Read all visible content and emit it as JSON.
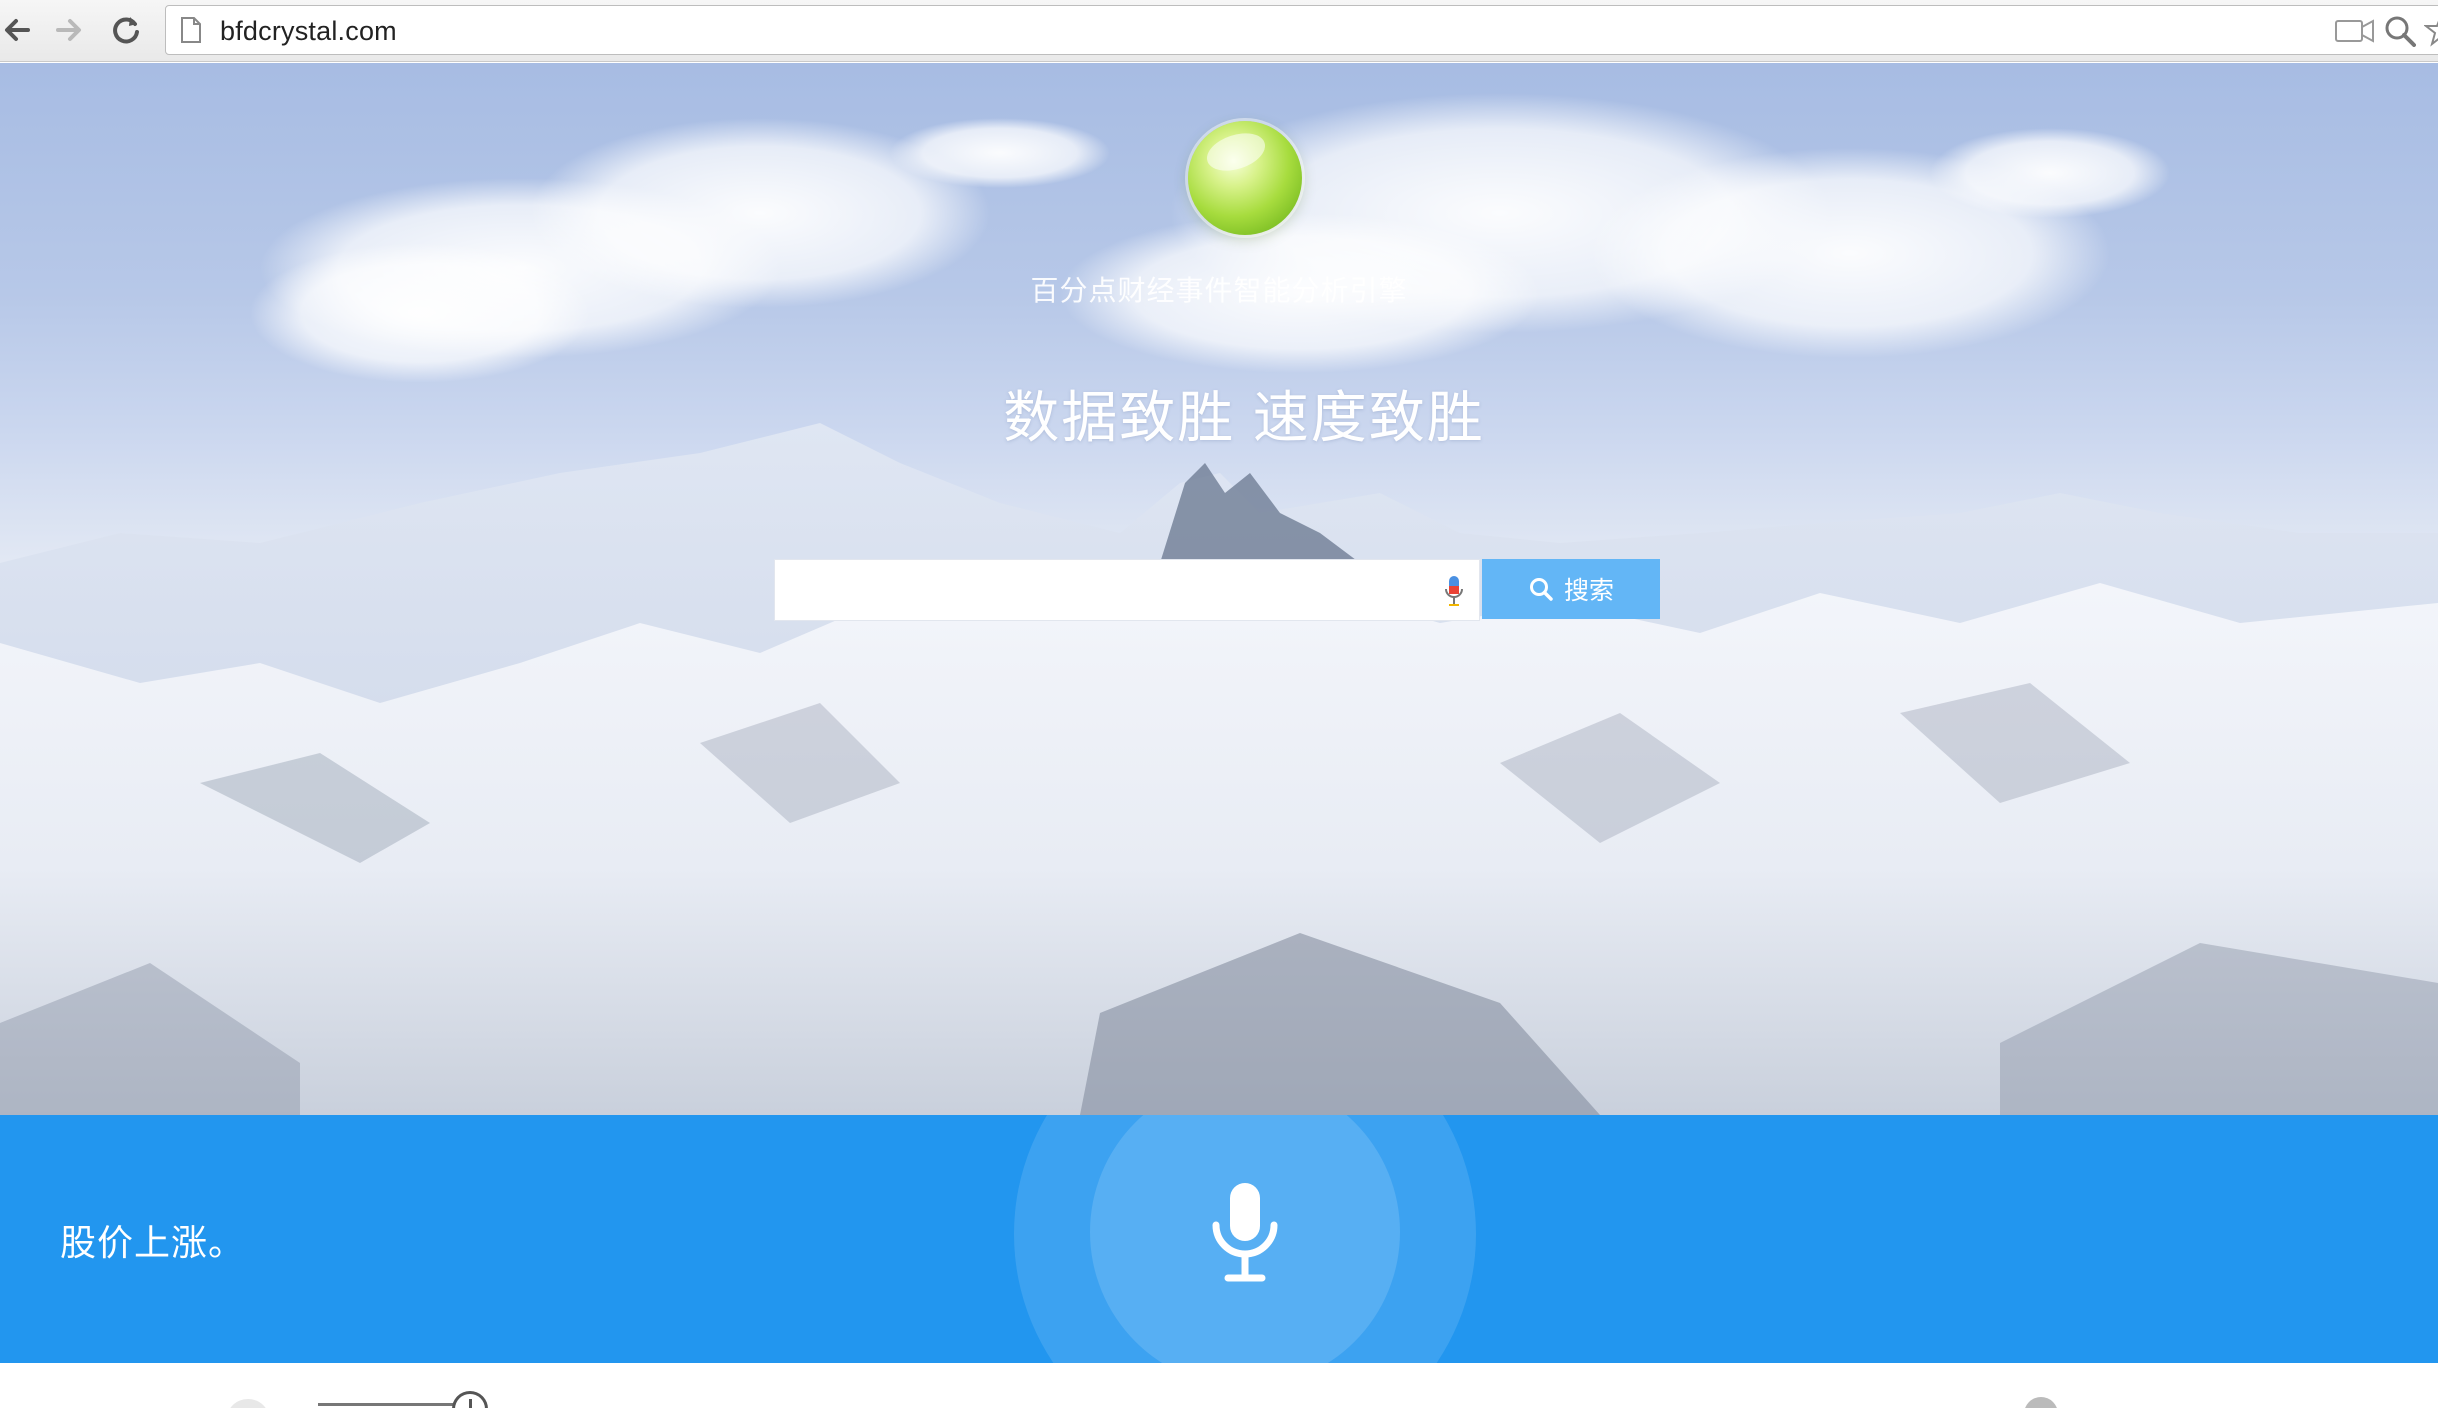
{
  "browser": {
    "url": "bfdcrystal.com",
    "icons": [
      "back-arrow-icon",
      "forward-arrow-icon",
      "reload-icon",
      "page-icon",
      "camera-icon",
      "zoom-icon",
      "star-icon"
    ]
  },
  "hero": {
    "logo_icon": "green-orb-logo",
    "tagline": "百分点财经事件智能分析引擎",
    "headline": "数据致胜 速度致胜",
    "search": {
      "value": "",
      "placeholder": "",
      "mic_icon": "microphone-icon",
      "button_label": "搜索",
      "button_icon": "search-icon"
    }
  },
  "voice": {
    "transcript": "股价上涨。",
    "mic_icon": "microphone-icon"
  },
  "colors": {
    "voice_bar": "#2296ef",
    "search_button": "#63b6f6",
    "logo_green": "#a7dc3e"
  }
}
